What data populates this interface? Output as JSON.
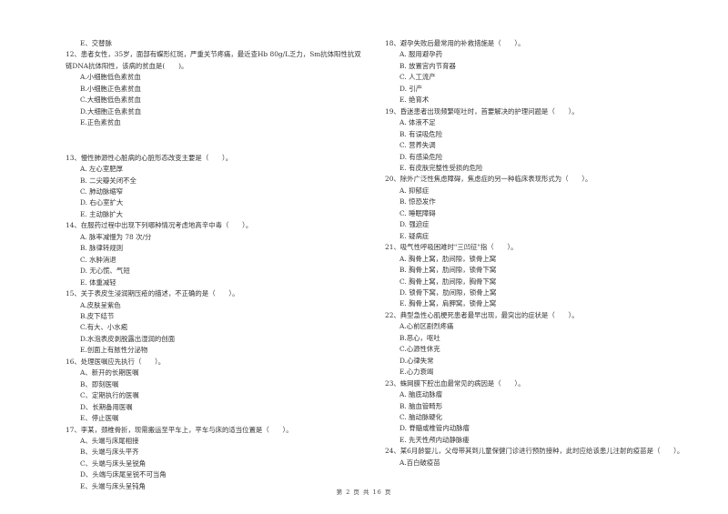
{
  "left_column": {
    "pre_option": "E、交替脉",
    "questions": [
      {
        "stem": "12、患者女性，35岁，面部有蝶形红斑，严重关节疼痛，最近查Hb 80g/L乏力，Sm抗体阳性抗双链DNA抗体阳性，该病的贫血是(　　)。",
        "options": [
          "A.小细胞低色素贫血",
          "B.小细胞正色素贫血",
          "C.大细胞低色素贫血",
          "D.大细胞正色素贫血",
          "E.正色素贫血"
        ]
      },
      {
        "stem": "13、慢性肺源性心脏病的心脏形态改变主要是（　　）。",
        "options": [
          "A. 左心室肥厚",
          "B. 二尖瓣关闭不全",
          "C. 肺动脉缩窄",
          "D. 右心室扩大",
          "E. 主动脉扩大"
        ]
      },
      {
        "stem": "14、在服药过程中出现下列哪种情况考虑地高辛中毒（　　）。",
        "options": [
          "A. 脉率减慢为 78 次/分",
          "B. 脉律转规则",
          "C. 水肿消退",
          "D. 无心慌、气短",
          "E. 体重减轻"
        ]
      },
      {
        "stem": "15、关于表皮生浸润期压疮的描述，不正确的是（　　）。",
        "options": [
          "A.皮肤呈紫色",
          "B.皮下结节",
          "C.有大、小水疱",
          "D.水泡表皮剥脱露出湿润的创面",
          "E.创面上有脓性分泌物"
        ]
      },
      {
        "stem": "16、处理医嘱应先执行（　　）。",
        "options": [
          "A、新开的长期医嘱",
          "B、即刻医嘱",
          "C、定期执行的医嘱",
          "D、长期备用医嘱",
          "E、停止医嘱"
        ]
      },
      {
        "stem": "17、李某，颈椎骨折，现需搬运至平车上，平车与床的适当位置是（　　）。",
        "options": [
          "A、头端与床尾相接",
          "B、头端与床头平齐",
          "C、头端与床头呈锐角",
          "D、头端与床尾呈锐不可当角",
          "E、头端与床头呈钝角"
        ]
      }
    ]
  },
  "right_column": {
    "questions": [
      {
        "stem": "18、避孕失败后最常用的补救措施是（　　）。",
        "options": [
          "A. 服用避孕药",
          "B. 放置宫内节育器",
          "C. 人工流产",
          "D. 引产",
          "E. 绝育术"
        ]
      },
      {
        "stem": "19、昏迷患者出现频繁呕吐时，首要解决的护理问题是（　　）。",
        "options": [
          "A. 体液不足",
          "B. 有误吸危险",
          "C. 营养失调",
          "D. 有感染危险",
          "E. 有皮肤完整性受损的危险"
        ]
      },
      {
        "stem": "20、除外广泛性焦虑障碍，焦虑症的另一种临床表现形式为（　　）。",
        "options": [
          "A. 抑郁症",
          "B. 惊恐发作",
          "C. 睡眠障碍",
          "D. 强迫症",
          "E. 疑病症"
        ]
      },
      {
        "stem": "21、吸气性呼吸困难时\"三凹征\"指（　　）。",
        "options": [
          "A. 胸骨上窝，肋间隙，锁骨上窝",
          "B. 胸骨上窝，肋间隙，锁骨下窝",
          "C. 胸骨上窝，肋间隙，胸骨下窝",
          "D. 锁骨下窝，肋间隙，锁骨上窝",
          "E. 胸骨上窝，肩胛窝，锁骨上窝"
        ]
      },
      {
        "stem": "22、典型急性心肌梗死患者最早出现，最突出的症状是（　　）。",
        "options": [
          "A.心前区剧烈疼痛",
          "B.恶心，呕吐",
          "C.心源性休克",
          "D.心律失常",
          "E.心力衰竭"
        ]
      },
      {
        "stem": "23、蛛网膜下腔出血最常见的病因是（　　）。",
        "options": [
          "A. 脑底动脉瘤",
          "B. 脑血管畸形",
          "C. 脑动脉硬化",
          "D. 脊髓或椎管内动脉瘤",
          "E. 先天性颅内动静脉瘘"
        ]
      },
      {
        "stem": "24、某6月龄婴儿，父母带其到儿童保健门诊进行预防接种，此时应给该患儿注射的疫苗是（　　）。",
        "options": [
          "A.百白破疫苗"
        ]
      }
    ]
  },
  "footer": {
    "page_label": "第 2 页 共 16 页"
  }
}
